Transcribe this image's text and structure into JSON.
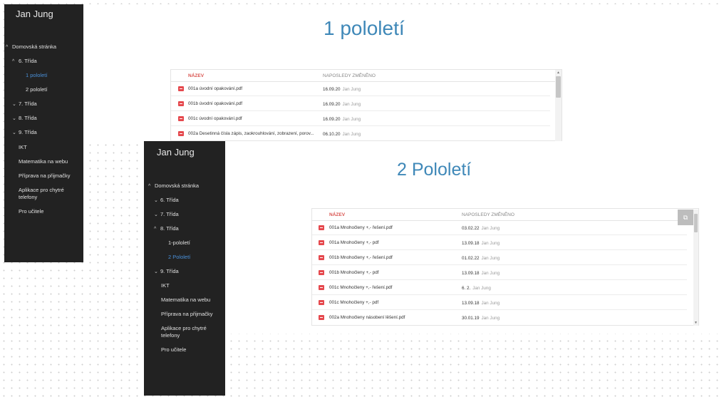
{
  "shotA": {
    "sidebar": {
      "brand": "Jan Jung",
      "items": [
        {
          "chev": "^",
          "label": "Domovská stránka"
        },
        {
          "chev": "^",
          "label": "6. Třída"
        },
        {
          "chev": "",
          "label": "1 pololetí"
        },
        {
          "chev": "",
          "label": "2 pololetí"
        },
        {
          "chev": "⌄",
          "label": "7. Třída"
        },
        {
          "chev": "⌄",
          "label": "8. Třída"
        },
        {
          "chev": "⌄",
          "label": "9. Třída"
        },
        {
          "chev": "",
          "label": "IKT"
        },
        {
          "chev": "",
          "label": "Matematika na webu"
        },
        {
          "chev": "",
          "label": "Příprava na přijmačky"
        },
        {
          "chev": "",
          "label": "Aplikace pro chytré telefony"
        },
        {
          "chev": "",
          "label": "Pro učitele"
        }
      ]
    },
    "title": "1 pololetí",
    "table": {
      "col_name": "NÁZEV",
      "col_modified": "NAPOSLEDY ZMĚNĚNO",
      "rows": [
        {
          "name": "001a úvodní opakování.pdf",
          "date": "16.09.20",
          "user": "Jan Jung"
        },
        {
          "name": "001b úvodní opakování.pdf",
          "date": "16.09.20",
          "user": "Jan Jung"
        },
        {
          "name": "001c úvodní opakování.pdf",
          "date": "16.09.20",
          "user": "Jan Jung"
        },
        {
          "name": "002a Desetinná čísla zápis, zaokrouhlování, zobrazení, porov...",
          "date": "06.10.20",
          "user": "Jan Jung"
        }
      ]
    }
  },
  "shotB": {
    "sidebar": {
      "brand": "Jan Jung",
      "items": [
        {
          "chev": "^",
          "label": "Domovská stránka"
        },
        {
          "chev": "⌄",
          "label": "6. Třída"
        },
        {
          "chev": "⌄",
          "label": "7. Třída"
        },
        {
          "chev": "^",
          "label": "8. Třída"
        },
        {
          "chev": "",
          "label": "1-pololetí"
        },
        {
          "chev": "",
          "label": "2 Pololetí"
        },
        {
          "chev": "⌄",
          "label": "9. Třída"
        },
        {
          "chev": "",
          "label": "IKT"
        },
        {
          "chev": "",
          "label": "Matematika na webu"
        },
        {
          "chev": "",
          "label": "Příprava na přijmačky"
        },
        {
          "chev": "",
          "label": "Aplikace pro chytré telefony"
        },
        {
          "chev": "",
          "label": "Pro učitele"
        }
      ]
    },
    "title": "2 Pololetí",
    "table": {
      "col_name": "NÁZEV",
      "col_modified": "NAPOSLEDY ZMĚNĚNO",
      "rows": [
        {
          "name": "001a Mnohočleny +,- řešení.pdf",
          "date": "03.02.22",
          "user": "Jan Jung"
        },
        {
          "name": "001a Mnohočleny +,- pdf",
          "date": "13.09.18",
          "user": "Jan Jung"
        },
        {
          "name": "001b Mnohočleny +,- řešení.pdf",
          "date": "01.02.22",
          "user": "Jan Jung"
        },
        {
          "name": "001b Mnohočleny +,- pdf",
          "date": "13.09.18",
          "user": "Jan Jung"
        },
        {
          "name": "001c Mnohočleny +,- řešení.pdf",
          "date": "6. 2.",
          "user": "Jan Jung"
        },
        {
          "name": "001c Mnohočleny +,- pdf",
          "date": "13.09.18",
          "user": "Jan Jung"
        },
        {
          "name": "002a Mnohočleny násobení lěšení.pdf",
          "date": "30.01.19",
          "user": "Jan Jung"
        }
      ]
    }
  },
  "icons": {
    "pdf": "pdf-file-icon",
    "popout": "open-in-new-icon",
    "scroll_up": "scroll-up-arrow-icon",
    "scroll_down": "scroll-down-arrow-icon"
  },
  "colors": {
    "sidebar_bg": "#222222",
    "active_link": "#4a90d9",
    "title": "#3f88b8",
    "name_header": "#d9534f",
    "pdf_icon": "#e5484d"
  }
}
